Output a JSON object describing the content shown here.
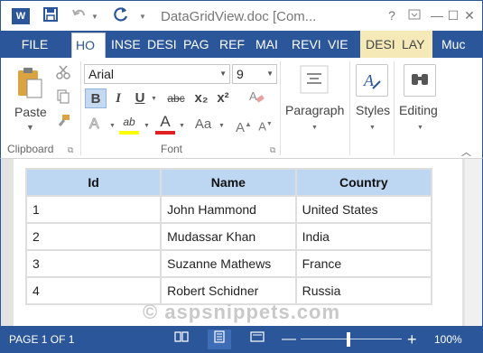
{
  "titlebar": {
    "app_icon": "W",
    "title": "DataGridView.doc [Com...",
    "qat": {
      "save": "save-icon",
      "undo": "undo-icon",
      "refresh": "refresh-icon"
    },
    "window": {
      "help": "?",
      "restore": "restore-icon",
      "minimize": "—",
      "maximize": "☐",
      "close": "✕"
    }
  },
  "tabs": [
    {
      "label": "FILE"
    },
    {
      "label": "HO"
    },
    {
      "label": "INSE"
    },
    {
      "label": "DESI"
    },
    {
      "label": "PAG"
    },
    {
      "label": "REF"
    },
    {
      "label": "MAI"
    },
    {
      "label": "REVI"
    },
    {
      "label": "VIE"
    },
    {
      "label": "DESI"
    },
    {
      "label": "LAY"
    },
    {
      "label": "Muc"
    }
  ],
  "ribbon": {
    "clipboard": {
      "paste": "Paste",
      "label": "Clipboard"
    },
    "font": {
      "name": "Arial",
      "size": "9",
      "bold": "B",
      "italic": "I",
      "underline": "U",
      "strike": "abc",
      "subscript": "x₂",
      "superscript": "x²",
      "grow": "A",
      "shrink": "A",
      "case": "Aa",
      "color_letter": "A",
      "highlight_letter": "ab",
      "highlight_color": "#ffff00",
      "font_color": "#e02020",
      "label": "Font"
    },
    "paragraph": {
      "label": "Paragraph"
    },
    "styles": {
      "label": "Styles"
    },
    "editing": {
      "label": "Editing"
    }
  },
  "grid": {
    "columns": [
      "Id",
      "Name",
      "Country"
    ],
    "rows": [
      [
        "1",
        "John Hammond",
        "United States"
      ],
      [
        "2",
        "Mudassar Khan",
        "India"
      ],
      [
        "3",
        "Suzanne Mathews",
        "France"
      ],
      [
        "4",
        "Robert Schidner",
        "Russia"
      ]
    ]
  },
  "watermark": "© aspsnippets.com",
  "status": {
    "page": "PAGE 1 OF 1",
    "zoom_out": "—",
    "zoom_in": "+",
    "zoom": "100%",
    "zoom_level": 1.0
  },
  "colors": {
    "accent": "#2b579a",
    "header_fill": "#bdd7f2"
  }
}
